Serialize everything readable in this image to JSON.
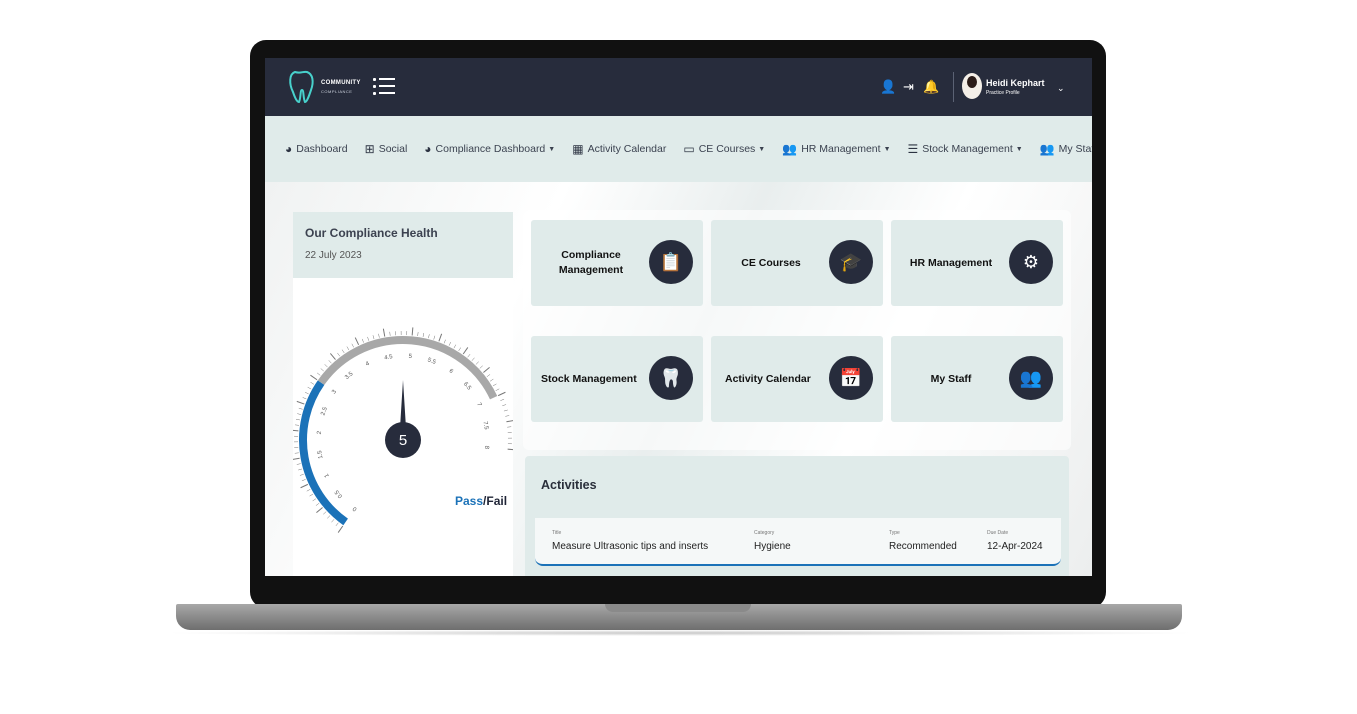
{
  "app": {
    "logo_text": "COMMUNITY",
    "logo_sub": "COMPLIANCE"
  },
  "user": {
    "name": "Heidi Kephart",
    "role": "Practice Profile"
  },
  "nav": {
    "items": [
      {
        "label": "Dashboard",
        "icon": "palette-icon",
        "caret": false
      },
      {
        "label": "Social",
        "icon": "sitemap-icon",
        "caret": false
      },
      {
        "label": "Compliance Dashboard",
        "icon": "palette-icon",
        "caret": true
      },
      {
        "label": "Activity Calendar",
        "icon": "calendar-icon",
        "caret": false
      },
      {
        "label": "CE Courses",
        "icon": "monitor-icon",
        "caret": true
      },
      {
        "label": "HR Management",
        "icon": "users-icon",
        "caret": true
      },
      {
        "label": "Stock Management",
        "icon": "server-icon",
        "caret": true
      },
      {
        "label": "My Staff",
        "icon": "users-icon",
        "caret": true
      }
    ]
  },
  "health": {
    "title": "Our Compliance Health",
    "date": "22 July 2023",
    "score": "5",
    "score_value": 5,
    "gauge_range": [
      0,
      8
    ],
    "gauge_fill_to": 3,
    "gauge_ticks": [
      "0",
      "0.5",
      "1",
      "1.5",
      "2",
      "2.5",
      "3",
      "3.5",
      "4",
      "4.5",
      "5",
      "5.5",
      "6",
      "6.5",
      "7",
      "7.5",
      "8"
    ],
    "pass_label": "Pass",
    "sep": "/",
    "fail_label": "Fail",
    "colors": {
      "fill": "#1b72b8",
      "track": "#a8a8a8",
      "needle": "#272c3c"
    }
  },
  "tiles": [
    {
      "label": "Compliance Management",
      "icon": "clipboard-check-icon",
      "glyph": "📋"
    },
    {
      "label": "CE Courses",
      "icon": "graduation-laptop-icon",
      "glyph": "🎓"
    },
    {
      "label": "HR Management",
      "icon": "people-gear-icon",
      "glyph": "⚙"
    },
    {
      "label": "Stock Management",
      "icon": "tooth-clipboard-icon",
      "glyph": "🦷"
    },
    {
      "label": "Activity Calendar",
      "icon": "calendar-tooth-icon",
      "glyph": "📅"
    },
    {
      "label": "My Staff",
      "icon": "staff-group-icon",
      "glyph": "👥"
    }
  ],
  "activities": {
    "title": "Activities",
    "headers": {
      "title": "Title",
      "category": "Category",
      "type": "Type",
      "due": "Due Date"
    },
    "rows": [
      {
        "title": "Measure Ultrasonic tips and inserts",
        "category": "Hygiene",
        "type": "Recommended",
        "due": "12-Apr-2024"
      }
    ]
  }
}
